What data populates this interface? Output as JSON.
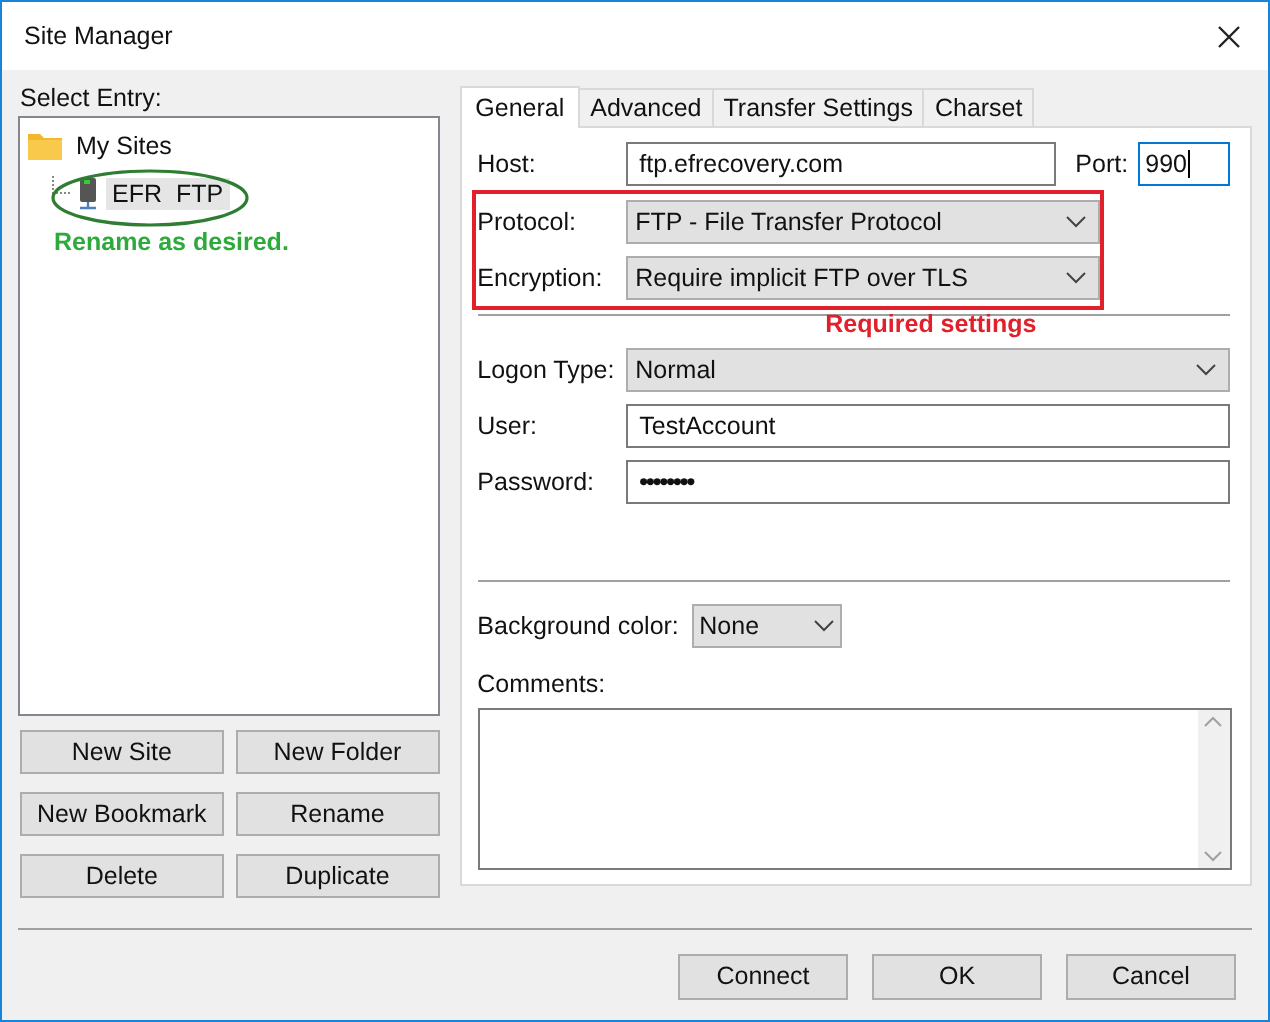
{
  "window": {
    "title": "Site Manager"
  },
  "sidebar": {
    "label": "Select Entry:",
    "tree": [
      {
        "label": "My Sites",
        "kind": "folder",
        "selected": false,
        "children": [
          {
            "label": "EFR  FTP",
            "kind": "site",
            "selected": true
          }
        ]
      }
    ],
    "annotation": "Rename as desired.",
    "buttons": [
      "New Site",
      "New Folder",
      "New Bookmark",
      "Rename",
      "Delete",
      "Duplicate"
    ]
  },
  "tabs": [
    {
      "label": "General",
      "selected": true
    },
    {
      "label": "Advanced",
      "selected": false
    },
    {
      "label": "Transfer Settings",
      "selected": false
    },
    {
      "label": "Charset",
      "selected": false
    }
  ],
  "host": {
    "label": "Host:",
    "value": "ftp.efrecovery.com"
  },
  "port": {
    "label": "Port:",
    "value": "990",
    "focused": true
  },
  "required_group": {
    "annotation": "Required settings",
    "fields": [
      {
        "label": "Protocol:",
        "value": "FTP - File Transfer Protocol",
        "kind": "select"
      },
      {
        "label": "Encryption:",
        "value": "Require implicit FTP over TLS",
        "kind": "select"
      }
    ]
  },
  "login_fields": [
    {
      "label": "Logon Type:",
      "value": "Normal",
      "kind": "select"
    },
    {
      "label": "User:",
      "value": "TestAccount",
      "kind": "text"
    },
    {
      "label": "Password:",
      "value": "••••••••",
      "kind": "password"
    }
  ],
  "background_color": {
    "label": "Background color:",
    "value": "None"
  },
  "comments": {
    "label": "Comments:"
  },
  "footer_buttons": [
    "Connect",
    "OK",
    "Cancel"
  ]
}
